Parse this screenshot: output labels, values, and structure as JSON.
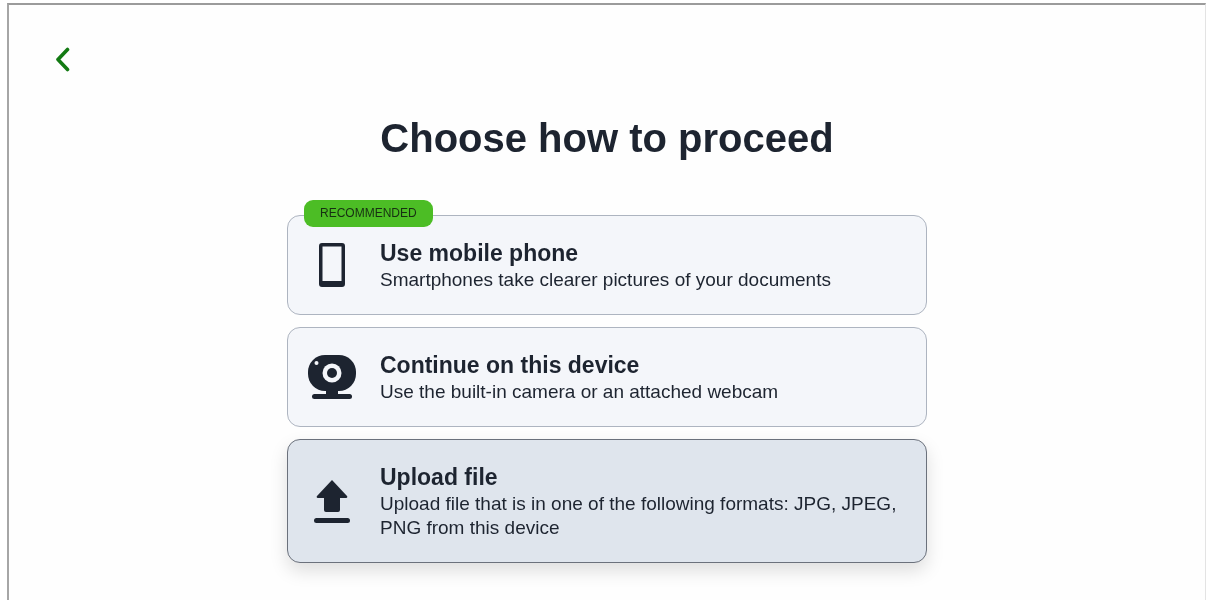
{
  "title": "Choose how to proceed",
  "options": [
    {
      "kind": "phone",
      "title": "Use mobile phone",
      "description": "Smartphones take clearer pictures of your documents",
      "badge": "RECOMMENDED",
      "selected": false
    },
    {
      "kind": "webcam",
      "title": "Continue on this device",
      "description": "Use the built-in camera or an attached webcam",
      "selected": false
    },
    {
      "kind": "upload",
      "title": "Upload file",
      "description": "Upload file that is in one of the following formats: JPG, JPEG, PNG from this device",
      "selected": true
    }
  ]
}
